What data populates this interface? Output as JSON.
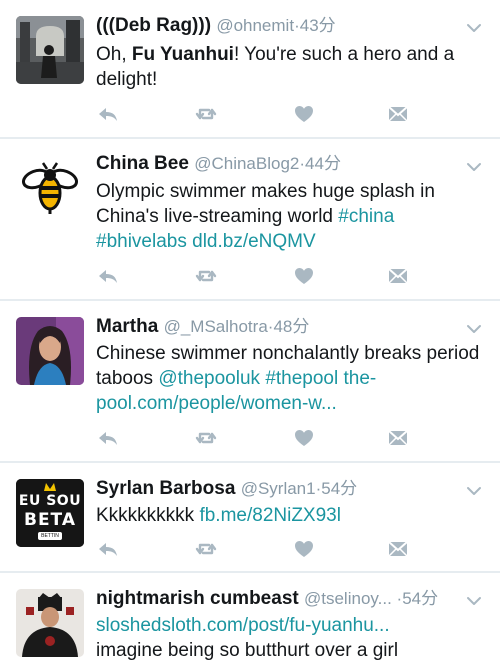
{
  "colors": {
    "background": "#e6ecf0",
    "card": "#ffffff",
    "name": "#14171a",
    "handle": "#8899a6",
    "link": "#1b95a0",
    "icon": "#aab8c2"
  },
  "tweets": [
    {
      "name": "(((Deb Rag)))",
      "handle": "@ohnemit",
      "time": "43分",
      "text_pre": "Oh, ",
      "text_bold": "Fu Yuanhui",
      "text_post": "! You're such a hero and a delight!",
      "avatar_icon": "photo-avatar"
    },
    {
      "name": "China Bee",
      "handle": "@ChinaBlog2",
      "time": "44分",
      "text": "Olympic swimmer makes huge splash in China's live-streaming world ",
      "tag1": "#china",
      "tag2": "#bhivelabs",
      "link": "dld.bz/eNQMV",
      "avatar_icon": "bee-icon"
    },
    {
      "name": "Martha",
      "handle": "@_MSalhotra",
      "time": "48分",
      "text": "Chinese swimmer nonchalantly breaks period taboos ",
      "mention": "@thepooluk",
      "tag": "#thepool",
      "link": "the-pool.com/people/women-w...",
      "avatar_icon": "photo-avatar"
    },
    {
      "name": "Syrlan Barbosa",
      "handle": "@Syrlan1",
      "time": "54分",
      "text": "Kkkkkkkkkk ",
      "link": "fb.me/82NiZX93l",
      "avatar_line1": "EU SOU",
      "avatar_line2": "BETA",
      "avatar_badge": "BETTIN"
    },
    {
      "name": "nightmarish cumbeast",
      "handle": "@tselinoy...",
      "time": "54分",
      "link": "sloshedsloth.com/post/fu-yuanhu...",
      "text": "imagine being so butthurt over a girl",
      "avatar_icon": "photo-avatar"
    }
  ],
  "actions": [
    "reply-icon",
    "retweet-icon",
    "like-icon",
    "dm-icon"
  ]
}
